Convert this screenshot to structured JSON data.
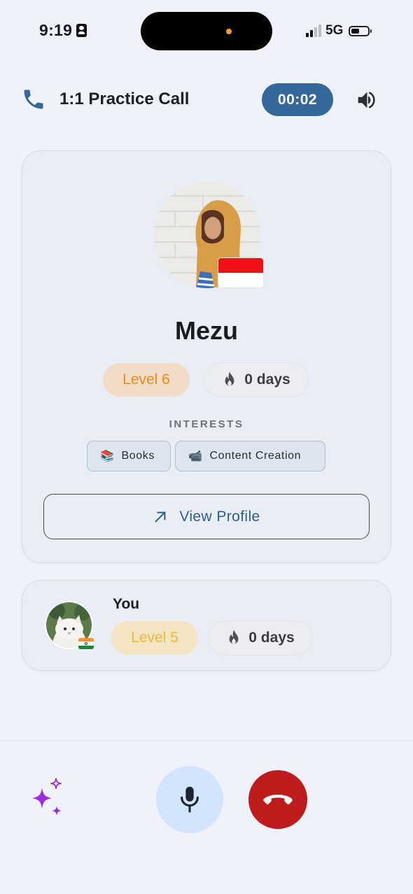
{
  "status_bar": {
    "time": "9:19",
    "network": "5G",
    "battery_fraction": 0.45,
    "icons": [
      "id-card-icon",
      "signal-icon",
      "battery-icon"
    ]
  },
  "header": {
    "title": "1:1 Practice Call",
    "timer": "00:02",
    "icons": [
      "phone-icon",
      "speaker-icon"
    ]
  },
  "partner": {
    "name": "Mezu",
    "flag": "Indonesia",
    "level": "Level 6",
    "streak": "0 days",
    "interests_heading": "INTERESTS",
    "interests": [
      {
        "emoji": "📚",
        "label": "Books"
      },
      {
        "emoji": "📹",
        "label": "Content Creation"
      }
    ],
    "view_profile_label": "View Profile"
  },
  "you": {
    "label": "You",
    "flag": "India",
    "level": "Level 5",
    "streak": "0 days"
  },
  "controls": {
    "icons": [
      "sparkle-icon",
      "microphone-icon",
      "hang-up-icon"
    ]
  },
  "colors": {
    "accent": "#34689a",
    "end_call": "#be1c1c",
    "mic_bg": "#d3e4fd",
    "sparkle": "#9b2de0"
  }
}
